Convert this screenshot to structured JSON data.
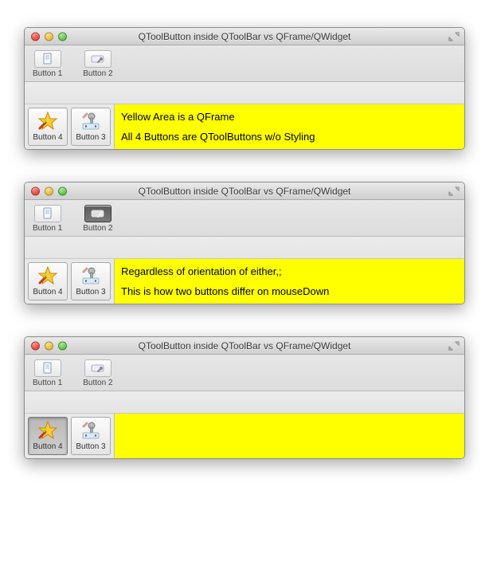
{
  "windows": [
    {
      "title": "QToolButton inside QToolBar vs QFrame/QWidget",
      "toolbar": {
        "button1": {
          "label": "Button 1",
          "pressed": false
        },
        "button2": {
          "label": "Button 2",
          "pressed": false
        }
      },
      "frame": {
        "button4": {
          "label": "Button 4",
          "pressed": false
        },
        "button3": {
          "label": "Button 3",
          "pressed": false
        },
        "line1": "Yellow Area is a QFrame",
        "line2": "All 4 Buttons are QToolButtons w/o Styling"
      }
    },
    {
      "title": "QToolButton inside QToolBar vs QFrame/QWidget",
      "toolbar": {
        "button1": {
          "label": "Button 1",
          "pressed": false
        },
        "button2": {
          "label": "Button 2",
          "pressed": true
        }
      },
      "frame": {
        "button4": {
          "label": "Button 4",
          "pressed": false
        },
        "button3": {
          "label": "Button 3",
          "pressed": false
        },
        "line1": "Regardless of orientation of either,;",
        "line2": "This is how two buttons differ on mouseDown"
      }
    },
    {
      "title": "QToolButton inside QToolBar vs QFrame/QWidget",
      "toolbar": {
        "button1": {
          "label": "Button 1",
          "pressed": false
        },
        "button2": {
          "label": "Button 2",
          "pressed": false
        }
      },
      "frame": {
        "button4": {
          "label": "Button 4",
          "pressed": true
        },
        "button3": {
          "label": "Button 3",
          "pressed": false
        },
        "line1": "",
        "line2": ""
      }
    }
  ]
}
